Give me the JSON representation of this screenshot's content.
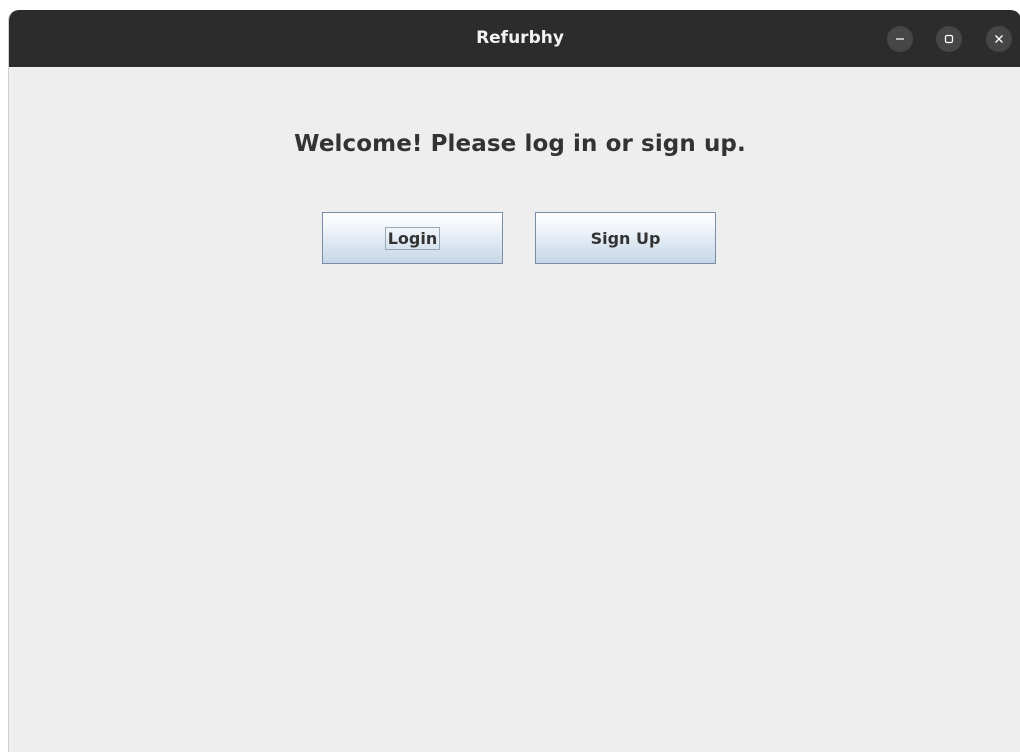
{
  "window": {
    "title": "Refurbhy",
    "controls": {
      "minimize_icon": "minimize-icon",
      "maximize_icon": "maximize-icon",
      "close_icon": "close-icon"
    }
  },
  "main": {
    "welcome_text": "Welcome! Please log in or sign up.",
    "login_label": "Login",
    "signup_label": "Sign Up"
  },
  "colors": {
    "titlebar": "#2c2c2c",
    "background": "#eeeeee",
    "button_border": "#7a8da8",
    "text": "#333333"
  }
}
